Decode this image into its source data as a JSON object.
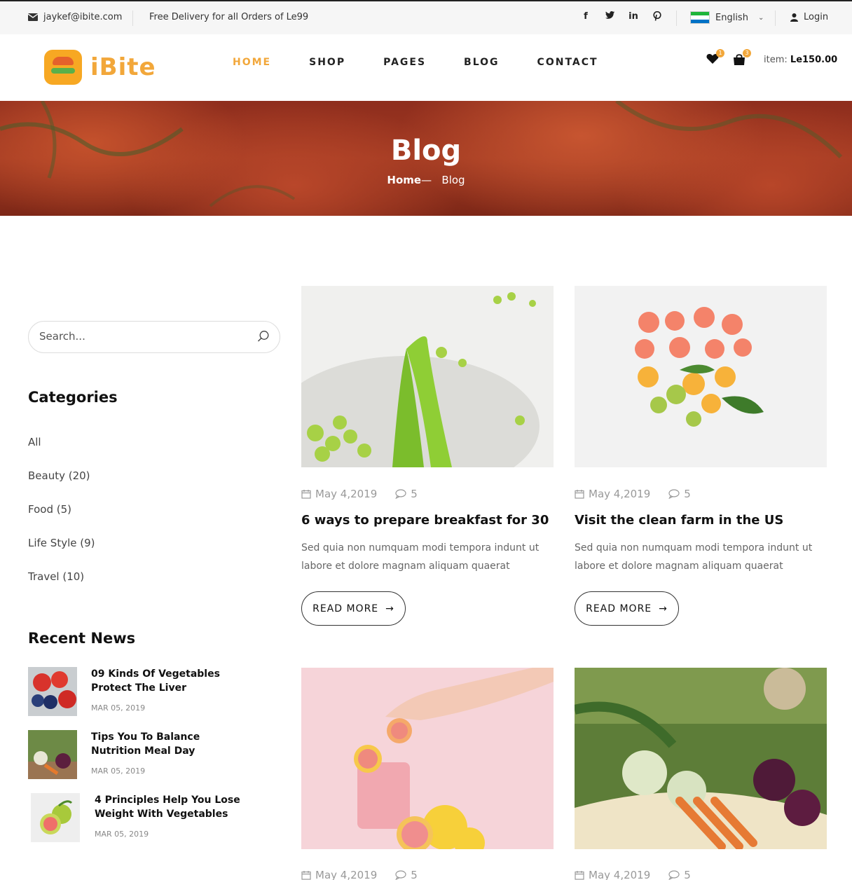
{
  "topbar": {
    "email": "jaykef@ibite.com",
    "delivery": "Free Delivery for all Orders of Le99",
    "social": [
      "facebook-icon",
      "twitter-icon",
      "linkedin-icon",
      "pinterest-icon"
    ],
    "language": "English",
    "login": "Login"
  },
  "header": {
    "logo_text": "iBite",
    "nav": [
      "HOME",
      "SHOP",
      "PAGES",
      "BLOG",
      "CONTACT"
    ],
    "wishlist_count": "1",
    "cart_count": "3",
    "cart_label": "item:",
    "cart_total": "Le150.00",
    "accent": "#f2a73a"
  },
  "hero": {
    "title": "Blog",
    "breadcrumb_home": "Home",
    "breadcrumb_sep": "—",
    "breadcrumb_current": "Blog"
  },
  "sidebar": {
    "search_placeholder": "Search...",
    "categories_heading": "Categories",
    "categories": [
      "All",
      "Beauty (20)",
      "Food (5)",
      "Life Style (9)",
      "Travel (10)"
    ],
    "recent_heading": "Recent News",
    "recent": [
      {
        "title": "09 Kinds Of Vegetables Protect The Liver",
        "date": "MAR 05, 2019"
      },
      {
        "title": "Tips You To Balance Nutrition Meal Day",
        "date": "MAR 05, 2019"
      },
      {
        "title": "4 Principles Help You Lose Weight With Vegetables",
        "date": "MAR 05, 2019"
      }
    ]
  },
  "posts": [
    {
      "date": "May 4,2019",
      "comments": "5",
      "title": "6 ways to prepare breakfast for 30",
      "excerpt": "Sed quia non numquam modi tempora indunt ut labore et dolore magnam aliquam quaerat",
      "button": "READ MORE"
    },
    {
      "date": "May 4,2019",
      "comments": "5",
      "title": "Visit the clean farm in the US",
      "excerpt": "Sed quia non numquam modi tempora indunt ut labore et dolore magnam aliquam quaerat",
      "button": "READ MORE"
    },
    {
      "date": "May 4,2019",
      "comments": "5"
    },
    {
      "date": "May 4,2019",
      "comments": "5"
    }
  ]
}
